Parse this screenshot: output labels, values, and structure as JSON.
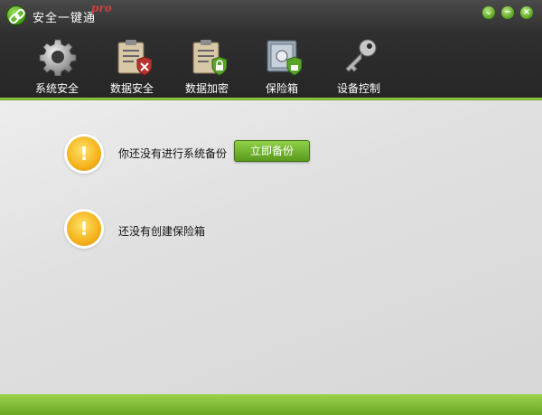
{
  "window": {
    "title": "安全一键通",
    "title_suffix": "pro"
  },
  "window_controls": {
    "menu": "⌄",
    "minimize": "−",
    "close": "×"
  },
  "toolbar": {
    "items": [
      {
        "label": "系统安全",
        "icon": "gear-icon"
      },
      {
        "label": "数据安全",
        "icon": "clipboard-shield-icon"
      },
      {
        "label": "数据加密",
        "icon": "clipboard-lock-icon"
      },
      {
        "label": "保险箱",
        "icon": "safe-icon"
      },
      {
        "label": "设备控制",
        "icon": "key-icon"
      }
    ]
  },
  "main": {
    "backup_warning": {
      "icon": "!",
      "text": "你还没有进行系统备份",
      "button": "立即备份"
    },
    "vault_warning": {
      "icon": "!",
      "text": "还没有创建保险箱"
    }
  },
  "colors": {
    "accent": "#7ab933",
    "titlebar": "#2b2b2b",
    "warning": "#f5b21a"
  }
}
